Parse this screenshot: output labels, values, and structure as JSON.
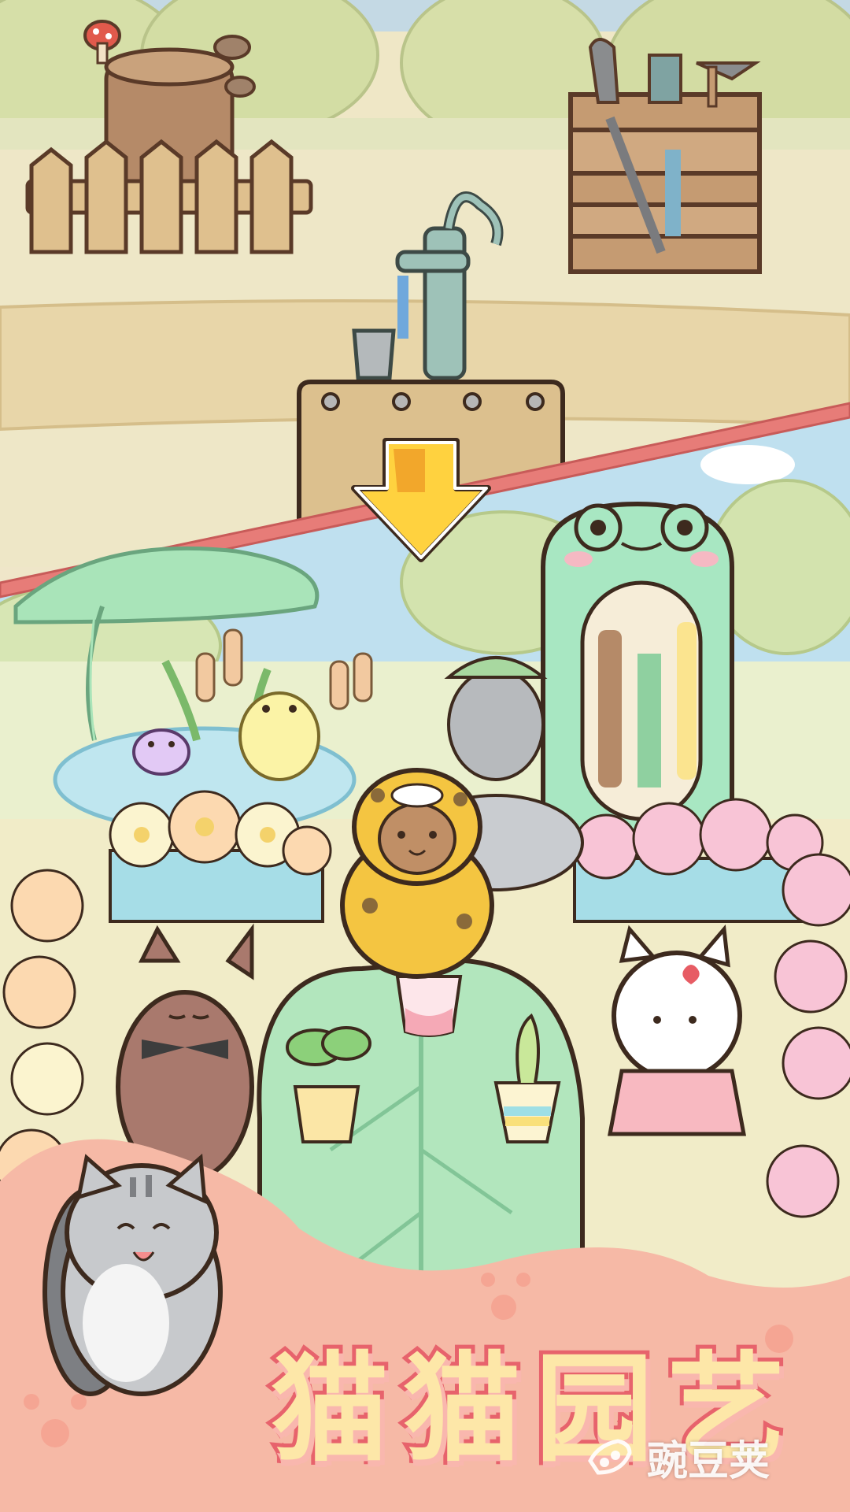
{
  "game": {
    "title": "猫猫园艺",
    "watermark": "豌豆荚",
    "scene_top": "pump-and-tools-area",
    "scene_bottom": "cat-garden",
    "hint_arrow": "down-arrow-icon"
  },
  "colors": {
    "sky": "#bfe0ef",
    "grass": "#f1ecc8",
    "leaf_green": "#a9e4b9",
    "frog_booth": "#a8e7c2",
    "arrow_yellow": "#ffd23f",
    "arrow_outline": "#3d2a1e",
    "divider_red": "#e77c78",
    "title_fill": "#fde7a8",
    "title_stroke": "#e7636c",
    "title_bg": "#f6b9a6"
  },
  "characters": [
    {
      "name": "leopard-costume-cat"
    },
    {
      "name": "brown-cat-bowtie"
    },
    {
      "name": "white-cat-gardener"
    },
    {
      "name": "gray-tabby-cat"
    }
  ]
}
